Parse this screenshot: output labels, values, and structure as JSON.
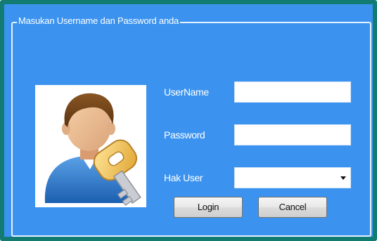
{
  "form": {
    "group_title": "Masukan Username dan Password anda",
    "labels": {
      "username": "UserName",
      "password": "Password",
      "hak_user": "Hak User"
    },
    "inputs": {
      "username_value": "",
      "password_value": "",
      "hak_user_value": ""
    },
    "buttons": {
      "login": "Login",
      "cancel": "Cancel"
    },
    "icons": {
      "avatar": "user-key-icon",
      "dropdown": "chevron-down-icon"
    }
  },
  "colors": {
    "window_frame": "#127c73",
    "panel_background": "#3b93ef",
    "label_text": "#ffffff"
  }
}
